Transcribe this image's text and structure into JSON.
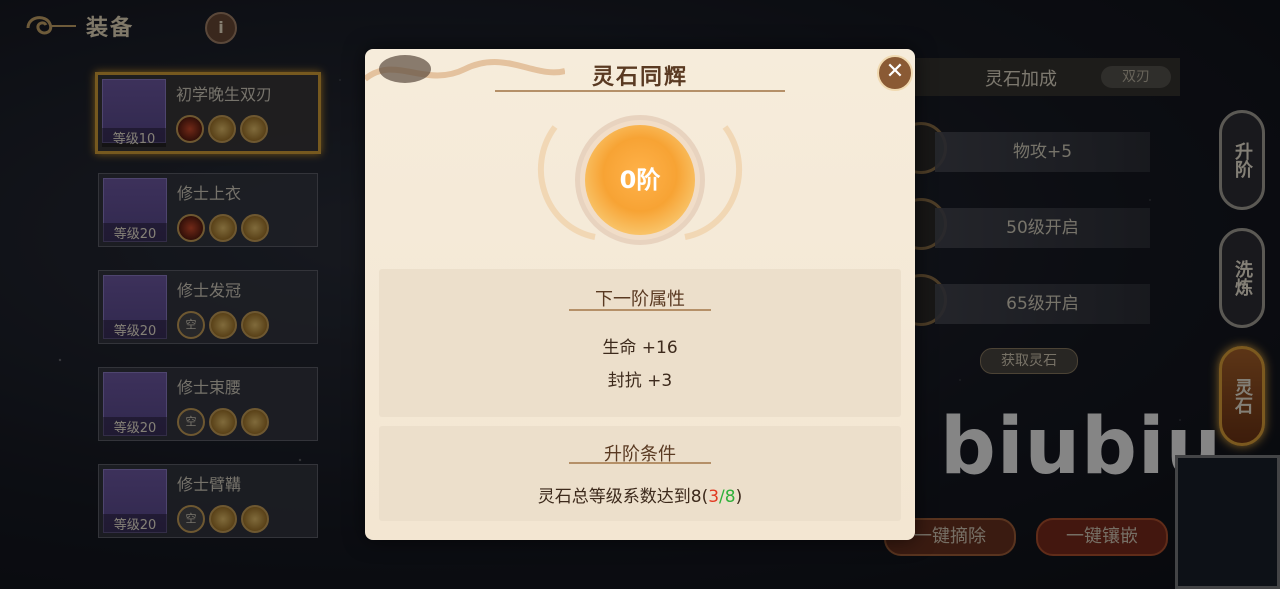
{
  "header": {
    "title": "装备",
    "info_label": "i"
  },
  "equipment": [
    {
      "name": "初学晚生双刃",
      "level": "等级10",
      "slots": [
        "red",
        "gold",
        "gold"
      ],
      "selected": true
    },
    {
      "name": "修士上衣",
      "level": "等级20",
      "slots": [
        "red",
        "gold",
        "gold"
      ],
      "selected": false
    },
    {
      "name": "修士发冠",
      "level": "等级20",
      "slots": [
        "空",
        "gold",
        "gold"
      ],
      "selected": false
    },
    {
      "name": "修士束腰",
      "level": "等级20",
      "slots": [
        "空",
        "gold",
        "gold"
      ],
      "selected": false
    },
    {
      "name": "修士臂鞲",
      "level": "等级20",
      "slots": [
        "空",
        "gold",
        "gold"
      ],
      "selected": false
    }
  ],
  "right_panel": {
    "title": "灵石加成",
    "weapon_tag": "双刃",
    "rows": [
      "物攻+5",
      "50级开启",
      "65级开启"
    ],
    "get_stone": "获取灵石",
    "tabs": [
      "升阶",
      "洗炼",
      "灵石"
    ],
    "remove_all": "一键摘除",
    "inlay_all": "一键镶嵌"
  },
  "watermark": "biubiu",
  "modal": {
    "title": "灵石同辉",
    "stage": "0阶",
    "next_title": "下一阶属性",
    "attributes": [
      "生命 +16",
      "封抗 +3"
    ],
    "cond_title": "升阶条件",
    "cond_prefix": "灵石总等级系数达到8",
    "cond_current": "3",
    "cond_required": "8",
    "close_symbol": "✕"
  },
  "colors": {
    "accent_gold": "#d7a23a",
    "cond_current": "#e23a22",
    "cond_required": "#2fb13a"
  }
}
